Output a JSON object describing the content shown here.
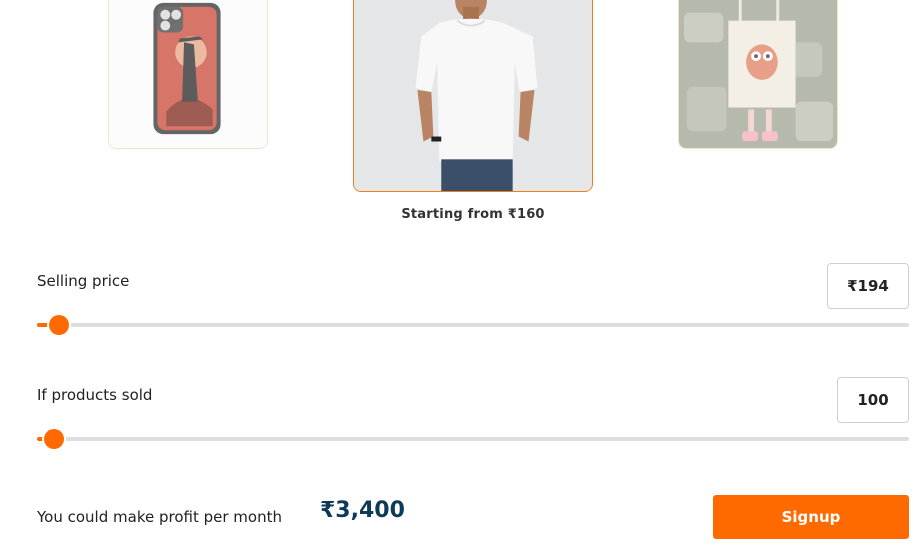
{
  "carousel": {
    "items": [
      {
        "name": "phone cover",
        "icon": "phone-case-image"
      },
      {
        "name": "t-shirt",
        "icon": "tshirt-image"
      },
      {
        "name": "tote bag",
        "icon": "tote-bag-image"
      }
    ],
    "active_caption": "Starting from ₹160"
  },
  "selling_price": {
    "label": "Selling price",
    "value": "₹194",
    "slider_fraction": 0.025
  },
  "products_sold": {
    "label": "If products sold",
    "value": "100",
    "slider_fraction": 0.02
  },
  "profit": {
    "label": "You could make profit per month",
    "value": "₹3,400"
  },
  "signup": {
    "label": "Signup"
  },
  "colors": {
    "accent": "#ff6a00",
    "profit_text": "#0e3a5a"
  }
}
